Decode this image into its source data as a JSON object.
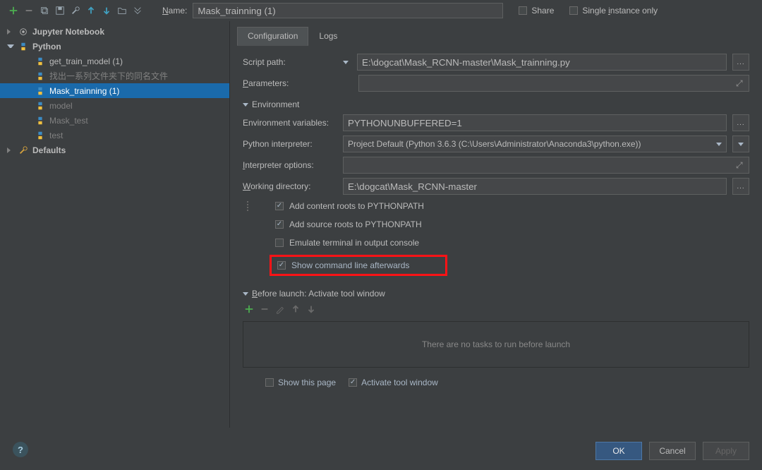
{
  "top": {
    "name_label": "Name:",
    "name_value": "Mask_trainning (1)",
    "share_label": "Share",
    "single_instance_label": "Single instance only"
  },
  "tree": {
    "jupyter": "Jupyter Notebook",
    "python": "Python",
    "items": [
      "get_train_model (1)",
      "找出一系列文件夹下的同名文件",
      "Mask_trainning (1)",
      "model",
      "Mask_test",
      "test"
    ],
    "defaults": "Defaults"
  },
  "tabs": {
    "config": "Configuration",
    "logs": "Logs"
  },
  "form": {
    "script_path_label": "Script path:",
    "script_path_value": "E:\\dogcat\\Mask_RCNN-master\\Mask_trainning.py",
    "parameters_label": "Parameters:",
    "parameters_value": "",
    "env_section": "Environment",
    "env_vars_label": "Environment variables:",
    "env_vars_value": "PYTHONUNBUFFERED=1",
    "python_interp_label": "Python interpreter:",
    "python_interp_value": "Project Default (Python 3.6.3 (C:\\Users\\Administrator\\Anaconda3\\python.exe))",
    "interp_opts_label": "Interpreter options:",
    "interp_opts_value": "",
    "working_dir_label": "Working directory:",
    "working_dir_value": "E:\\dogcat\\Mask_RCNN-master",
    "add_content_roots": "Add content roots to PYTHONPATH",
    "add_source_roots": "Add source roots to PYTHONPATH",
    "emulate_terminal": "Emulate terminal in output console",
    "show_cmdline": "Show command line afterwards"
  },
  "before_launch": {
    "section": "Before launch: Activate tool window",
    "empty": "There are no tasks to run before launch",
    "show_this_page": "Show this page",
    "activate_tool": "Activate tool window"
  },
  "buttons": {
    "ok": "OK",
    "cancel": "Cancel",
    "apply": "Apply"
  },
  "misc": {
    "ellipsis": "..."
  }
}
